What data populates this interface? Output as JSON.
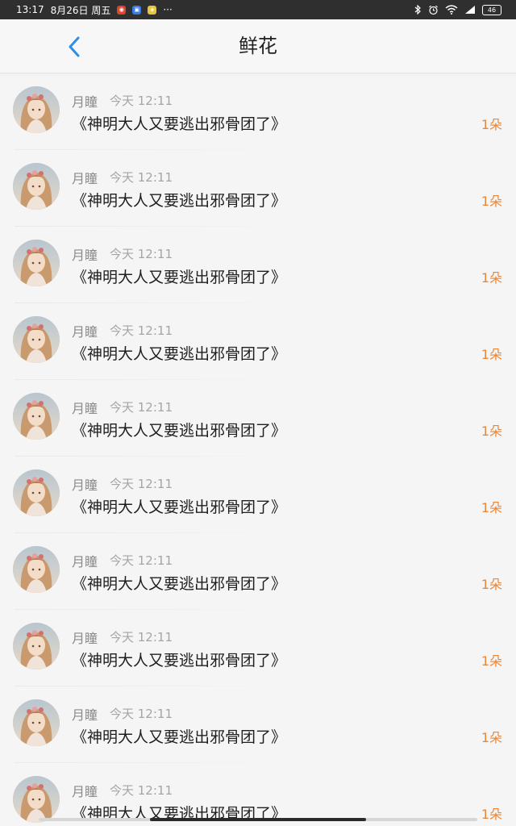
{
  "status_bar": {
    "time": "13:17",
    "date": "8月26日 周五",
    "more": "···",
    "battery": "46"
  },
  "header": {
    "title": "鲜花",
    "back_icon": "chevron-left-icon"
  },
  "colors": {
    "accent_back": "#2b8fe3",
    "flower_count": "#e8873a",
    "status_bar_bg": "#2f2f2f"
  },
  "items": [
    {
      "user": "月瞳",
      "time": "今天 12:11",
      "title": "《神明大人又要逃出邪骨团了》",
      "count": "1朵"
    },
    {
      "user": "月瞳",
      "time": "今天 12:11",
      "title": "《神明大人又要逃出邪骨团了》",
      "count": "1朵"
    },
    {
      "user": "月瞳",
      "time": "今天 12:11",
      "title": "《神明大人又要逃出邪骨团了》",
      "count": "1朵"
    },
    {
      "user": "月瞳",
      "time": "今天 12:11",
      "title": "《神明大人又要逃出邪骨团了》",
      "count": "1朵"
    },
    {
      "user": "月瞳",
      "time": "今天 12:11",
      "title": "《神明大人又要逃出邪骨团了》",
      "count": "1朵"
    },
    {
      "user": "月瞳",
      "time": "今天 12:11",
      "title": "《神明大人又要逃出邪骨团了》",
      "count": "1朵"
    },
    {
      "user": "月瞳",
      "time": "今天 12:11",
      "title": "《神明大人又要逃出邪骨团了》",
      "count": "1朵"
    },
    {
      "user": "月瞳",
      "time": "今天 12:11",
      "title": "《神明大人又要逃出邪骨团了》",
      "count": "1朵"
    },
    {
      "user": "月瞳",
      "time": "今天 12:11",
      "title": "《神明大人又要逃出邪骨团了》",
      "count": "1朵"
    },
    {
      "user": "月瞳",
      "time": "今天 12:11",
      "title": "《神明大人又要逃出邪骨团了》",
      "count": "1朵"
    }
  ]
}
